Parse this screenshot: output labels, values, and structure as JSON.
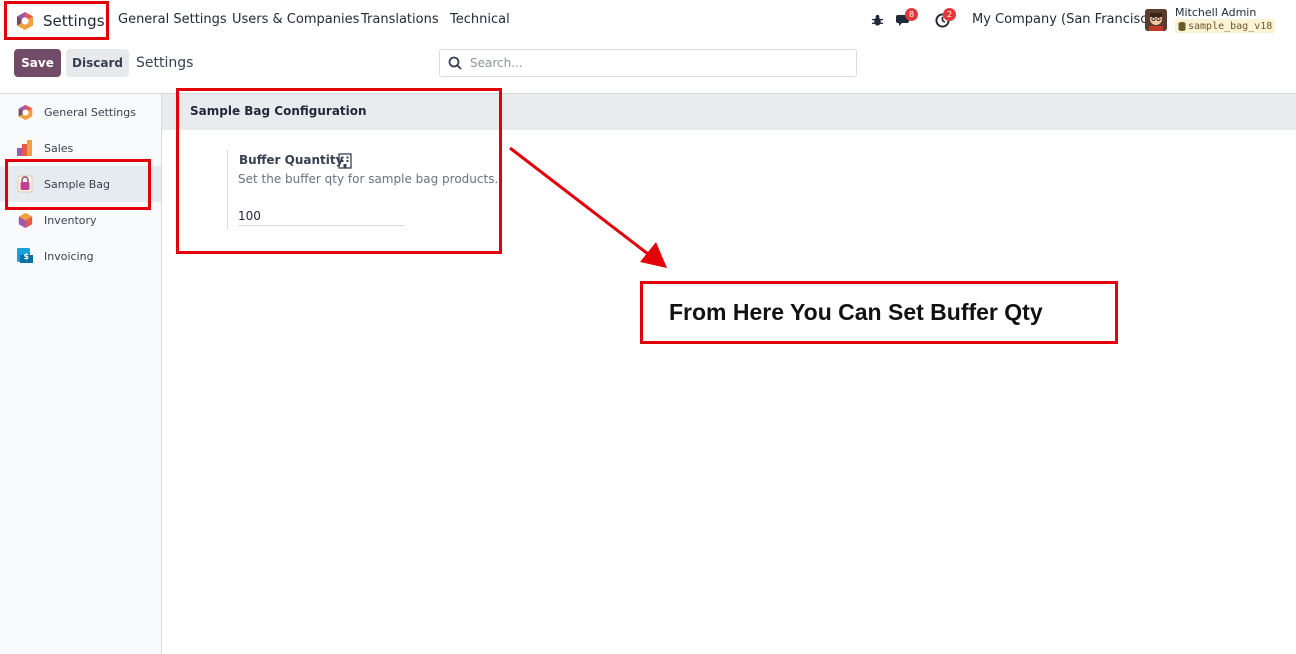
{
  "navbar": {
    "app_name": "Settings",
    "menu": [
      "General Settings",
      "Users & Companies",
      "Translations",
      "Technical"
    ],
    "messages_count": "8",
    "activities_count": "2",
    "company": "My Company (San Francisco)",
    "user_name": "Mitchell Admin",
    "database": "sample_bag_v18"
  },
  "control_panel": {
    "save_label": "Save",
    "discard_label": "Discard",
    "title": "Settings",
    "search_placeholder": "Search..."
  },
  "sidebar": {
    "items": [
      {
        "label": "General Settings",
        "icon": "odoo-logo-icon"
      },
      {
        "label": "Sales",
        "icon": "sales-chart-icon"
      },
      {
        "label": "Sample Bag",
        "icon": "sample-bag-icon",
        "active": true
      },
      {
        "label": "Inventory",
        "icon": "inventory-box-icon"
      },
      {
        "label": "Invoicing",
        "icon": "invoicing-icon"
      }
    ]
  },
  "section": {
    "title": "Sample Bag Configuration",
    "setting_label": "Buffer Quantity",
    "setting_help": "Set the buffer qty for sample bag products.",
    "setting_value": "100"
  },
  "annotation": {
    "text": "From Here You Can Set Buffer Qty"
  },
  "colors": {
    "brand": "#714b67",
    "highlight": "#e3000b",
    "badge": "#e23a3a"
  }
}
